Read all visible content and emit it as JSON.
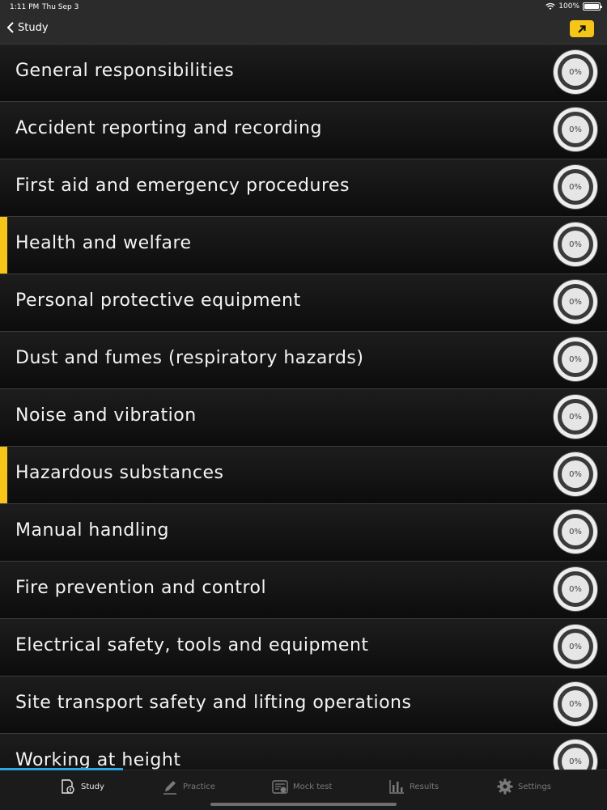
{
  "status_bar": {
    "time": "1:11 PM",
    "date": "Thu Sep 3",
    "battery": "100%"
  },
  "nav": {
    "back_label": "Study"
  },
  "topics": [
    {
      "title": "General responsibilities",
      "progress": "0%",
      "highlight": false
    },
    {
      "title": "Accident reporting and recording",
      "progress": "0%",
      "highlight": false
    },
    {
      "title": "First aid and emergency procedures",
      "progress": "0%",
      "highlight": false
    },
    {
      "title": "Health and welfare",
      "progress": "0%",
      "highlight": true
    },
    {
      "title": "Personal protective equipment",
      "progress": "0%",
      "highlight": false
    },
    {
      "title": "Dust and fumes (respiratory hazards)",
      "progress": "0%",
      "highlight": false
    },
    {
      "title": "Noise and vibration",
      "progress": "0%",
      "highlight": false
    },
    {
      "title": "Hazardous substances",
      "progress": "0%",
      "highlight": true
    },
    {
      "title": "Manual handling",
      "progress": "0%",
      "highlight": false
    },
    {
      "title": "Fire prevention and control",
      "progress": "0%",
      "highlight": false
    },
    {
      "title": "Electrical safety, tools and equipment",
      "progress": "0%",
      "highlight": false
    },
    {
      "title": "Site transport safety and lifting operations",
      "progress": "0%",
      "highlight": false
    },
    {
      "title": "Working at height",
      "progress": "0%",
      "highlight": false
    }
  ],
  "tabs": [
    {
      "label": "Study",
      "icon": "study-icon",
      "active": true
    },
    {
      "label": "Practice",
      "icon": "pencil-icon",
      "active": false
    },
    {
      "label": "Mock test",
      "icon": "mock-test-icon",
      "active": false
    },
    {
      "label": "Results",
      "icon": "bar-chart-icon",
      "active": false
    },
    {
      "label": "Settings",
      "icon": "gear-icon",
      "active": false
    }
  ],
  "colors": {
    "accent": "#f5c518",
    "tab_progress": "#2aa6e0"
  }
}
